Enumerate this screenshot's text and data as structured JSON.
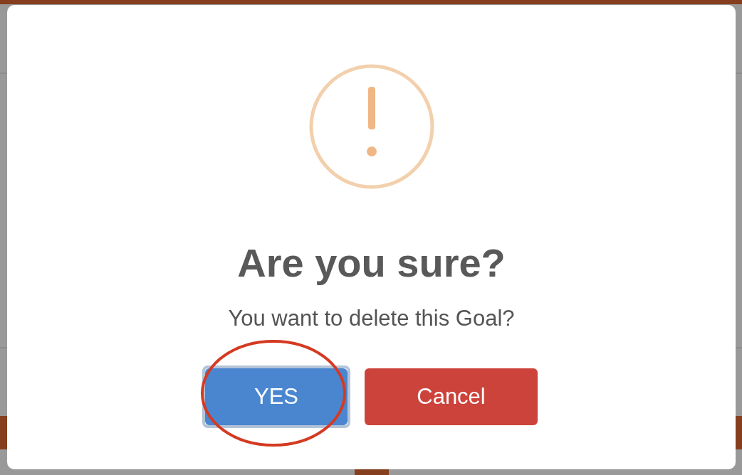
{
  "dialog": {
    "title": "Are you sure?",
    "message": "You want to delete this Goal?",
    "buttons": [
      {
        "label": "YES",
        "kind": "confirm",
        "focused": true,
        "circled": true
      },
      {
        "label": "Cancel",
        "kind": "cancel",
        "focused": false,
        "circled": false
      }
    ]
  }
}
